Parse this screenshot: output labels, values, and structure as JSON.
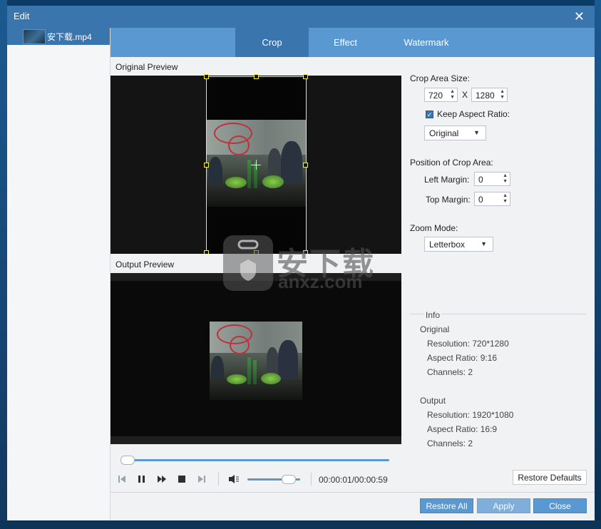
{
  "window": {
    "title": "Edit",
    "close_label": "✕"
  },
  "file_list": [
    {
      "name": "安下载.mp4"
    }
  ],
  "tabs": [
    {
      "label": "Crop",
      "active": true
    },
    {
      "label": "Effect",
      "active": false
    },
    {
      "label": "Watermark",
      "active": false
    }
  ],
  "previews": {
    "original_label": "Original Preview",
    "output_label": "Output Preview"
  },
  "playback": {
    "time": "00:00:01/00:00:59",
    "progress": 0.0,
    "volume": 0.85
  },
  "crop": {
    "area_size_label": "Crop Area Size:",
    "width": "720",
    "x_label": "X",
    "height": "1280",
    "keep_aspect_label": "Keep Aspect Ratio:",
    "keep_aspect_checked": true,
    "aspect_option": "Original",
    "position_label": "Position of Crop Area:",
    "left_margin_label": "Left Margin:",
    "left_margin": "0",
    "top_margin_label": "Top Margin:",
    "top_margin": "0",
    "zoom_label": "Zoom Mode:",
    "zoom_option": "Letterbox"
  },
  "info": {
    "title": "Info",
    "original": {
      "heading": "Original",
      "resolution": "Resolution: 720*1280",
      "aspect": "Aspect Ratio: 9:16",
      "channels": "Channels: 2"
    },
    "output": {
      "heading": "Output",
      "resolution": "Resolution: 1920*1080",
      "aspect": "Aspect Ratio: 16:9",
      "channels": "Channels: 2"
    }
  },
  "buttons": {
    "restore_defaults": "Restore Defaults",
    "restore_all": "Restore All",
    "apply": "Apply",
    "close": "Close"
  },
  "watermark": {
    "line1": "安下载",
    "line2": "anxz.com"
  },
  "colors": {
    "title_bar": "#3a75ad",
    "tab_bar": "#5a98d2",
    "crop_frame": "#f3f04a",
    "accent": "#5a98d2"
  }
}
